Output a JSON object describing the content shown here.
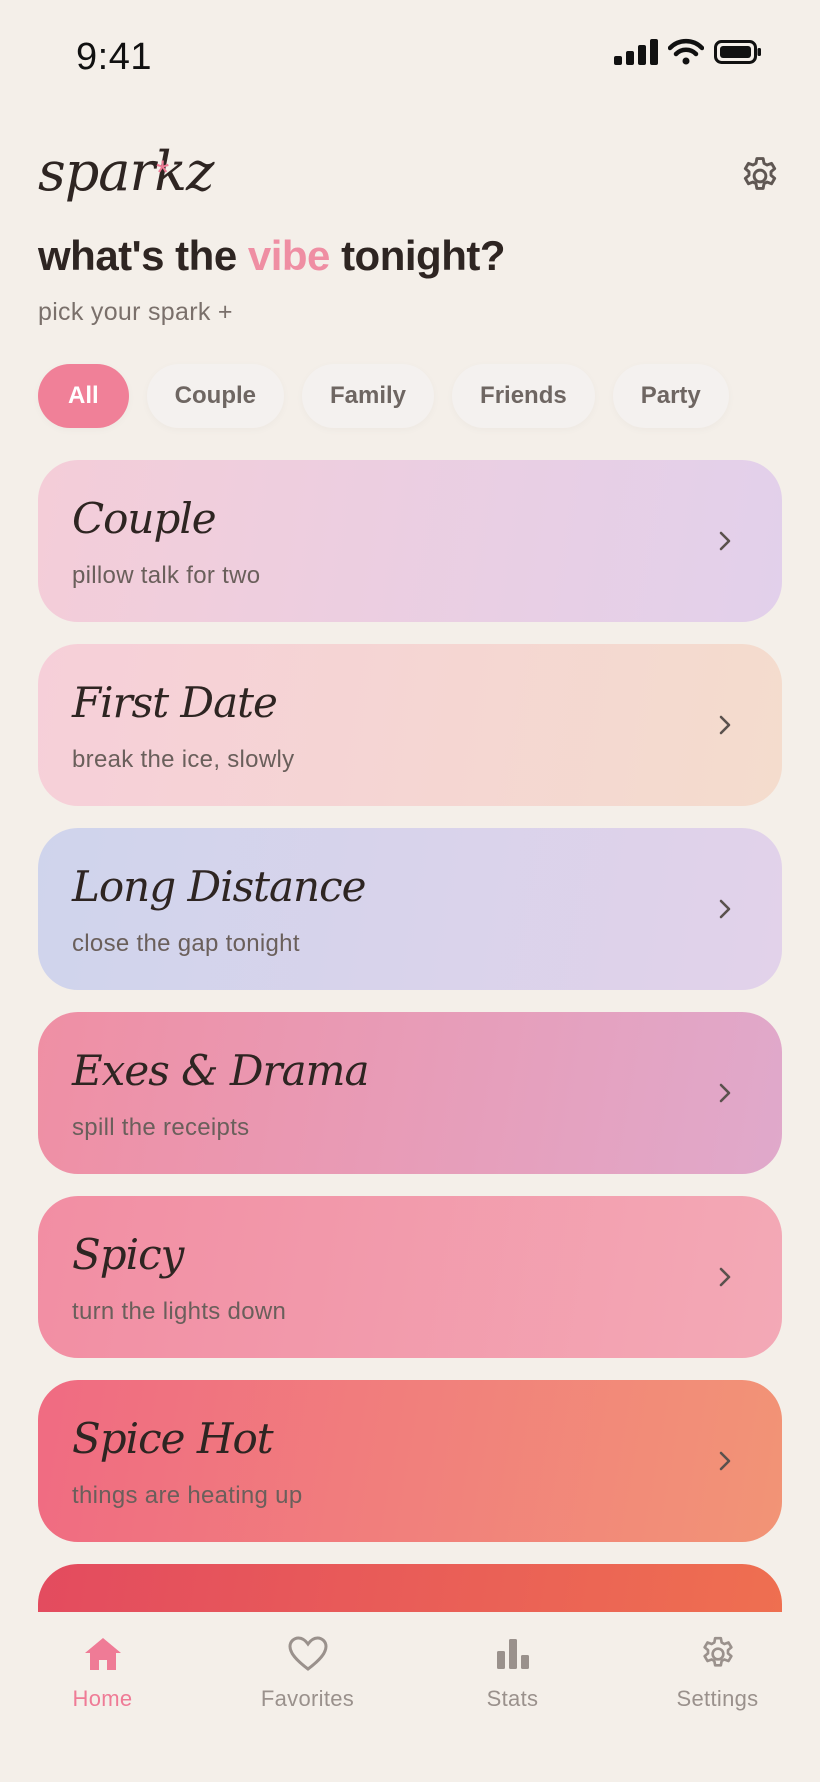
{
  "status": {
    "time": "9:41"
  },
  "brand": {
    "name": "sparkz",
    "star": "*"
  },
  "header": {
    "headline_pre": "what's the ",
    "headline_accent": "vibe",
    "headline_post": " tonight?",
    "subhead": "pick your spark  +"
  },
  "filters": {
    "selected": "All",
    "chips": [
      "All",
      "Couple",
      "Family",
      "Friends",
      "Party"
    ]
  },
  "cards": [
    {
      "title": "Couple",
      "subtitle": "pillow talk for two",
      "colors": [
        "#f4cdd8",
        "#e2d0eb"
      ]
    },
    {
      "title": "First Date",
      "subtitle": "break the ice, slowly",
      "colors": [
        "#f6cfd9",
        "#f4dccd"
      ]
    },
    {
      "title": "Long Distance",
      "subtitle": "close the gap tonight",
      "colors": [
        "#cfd4ec",
        "#e2d2ea"
      ]
    },
    {
      "title": "Exes & Drama",
      "subtitle": "spill the receipts",
      "colors": [
        "#ef8fa4",
        "#e0a9cb"
      ]
    },
    {
      "title": "Spicy",
      "subtitle": "turn the lights down",
      "colors": [
        "#f28ea3",
        "#f3a9b6"
      ]
    },
    {
      "title": "Spice Hot",
      "subtitle": "things are heating up",
      "colors": [
        "#f06b82",
        "#f29476"
      ]
    },
    {
      "title": "",
      "subtitle": "",
      "colors": [
        "#e34b5f",
        "#ef7050"
      ]
    }
  ],
  "tabs": [
    {
      "label": "Home",
      "icon": "home-icon"
    },
    {
      "label": "Favorites",
      "icon": "heart-icon"
    },
    {
      "label": "Stats",
      "icon": "bar-chart-icon"
    },
    {
      "label": "Settings",
      "icon": "gear-icon"
    }
  ],
  "colors": {
    "background": "#f4efe9",
    "accent": "#ef7b96",
    "text": "#2e2522",
    "muted": "#9a918c"
  }
}
